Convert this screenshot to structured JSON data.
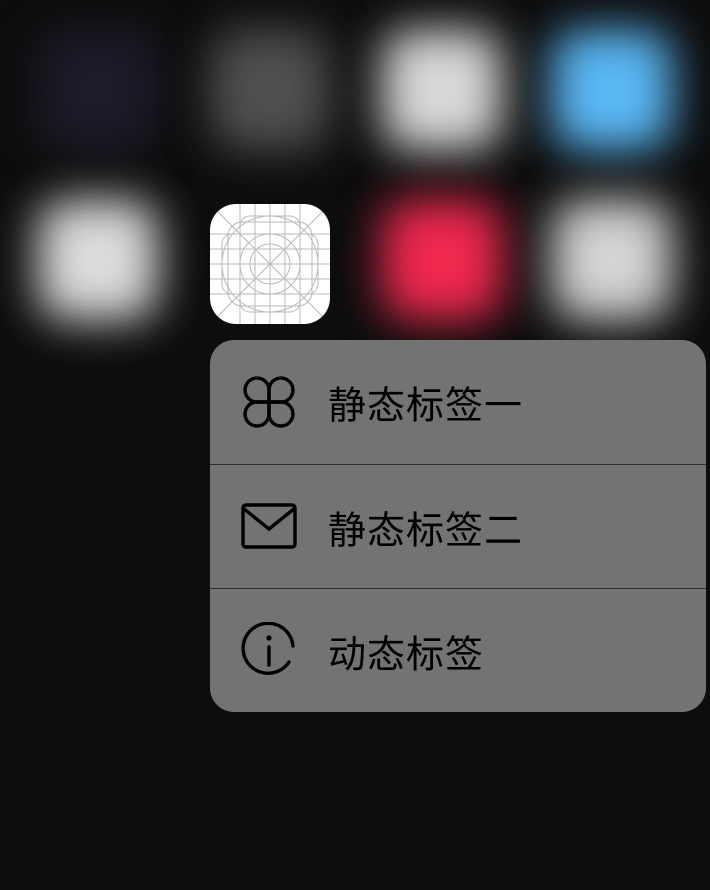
{
  "background_icons": [
    {
      "name": "app-1",
      "color": "#1c1c2a"
    },
    {
      "name": "app-2",
      "color": "#505050"
    },
    {
      "name": "app-3",
      "color": "#d8d8d8"
    },
    {
      "name": "app-4",
      "color": "#5ab8f5"
    },
    {
      "name": "app-5",
      "color": "#dcdcdc"
    },
    {
      "name": "app-6",
      "color": "#f0284e"
    },
    {
      "name": "app-7",
      "color": "#d4d4d4"
    }
  ],
  "pressed_app": {
    "icon": "app-icon-template-grid"
  },
  "menu": {
    "background_color": "#737373",
    "items": [
      {
        "label": "静态标签一",
        "icon": "command-icon"
      },
      {
        "label": "静态标签二",
        "icon": "mail-icon"
      },
      {
        "label": "动态标签",
        "icon": "info-icon"
      }
    ]
  }
}
